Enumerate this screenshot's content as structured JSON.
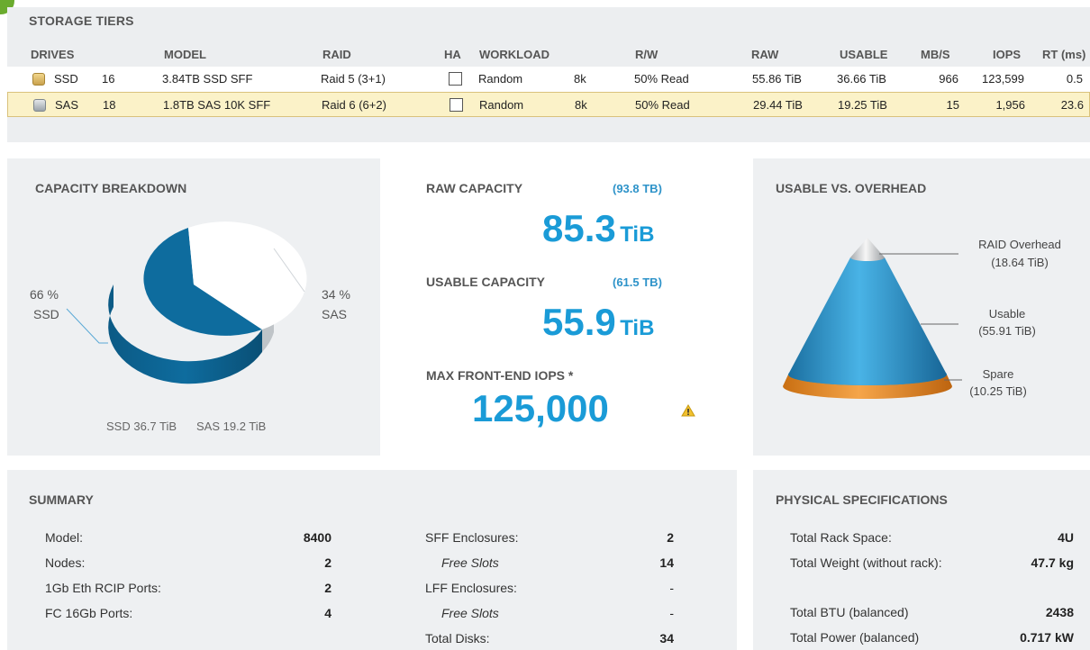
{
  "tiers": {
    "title": "STORAGE TIERS",
    "headers": [
      "DRIVES",
      "MODEL",
      "RAID",
      "HA",
      "WORKLOAD",
      "R/W",
      "RAW",
      "USABLE",
      "MB/S",
      "IOPS",
      "RT (ms)"
    ],
    "rows": [
      {
        "type": "SSD",
        "count": "16",
        "model": "3.84TB SSD SFF",
        "raid": "Raid 5 (3+1)",
        "ha": false,
        "workload": "Random",
        "block": "8k",
        "rw": "50% Read",
        "raw": "55.86 TiB",
        "usable": "36.66 TiB",
        "mbs": "966",
        "iops": "123,599",
        "rt": "0.5",
        "icon": "ssd-drive-icon"
      },
      {
        "type": "SAS",
        "count": "18",
        "model": "1.8TB SAS 10K SFF",
        "raid": "Raid 6 (6+2)",
        "ha": false,
        "workload": "Random",
        "block": "8k",
        "rw": "50% Read",
        "raw": "29.44 TiB",
        "usable": "19.25 TiB",
        "mbs": "15",
        "iops": "1,956",
        "rt": "23.6",
        "icon": "sas-drive-icon",
        "selected": true
      }
    ]
  },
  "capacity_breakdown": {
    "title": "CAPACITY BREAKDOWN",
    "ssd_pct": "66 %",
    "ssd_label": "SSD",
    "sas_pct": "34 %",
    "sas_label": "SAS",
    "ssd_fraction": 0.66,
    "legend_ssd": "SSD  36.7 TiB",
    "legend_sas": "SAS  19.2 TiB",
    "colors": {
      "ssd": "#0e6c9e",
      "sas": "#ffffff"
    }
  },
  "capacity": {
    "raw_label": "RAW CAPACITY",
    "raw_paren": "(93.8 TB)",
    "raw_value": "85.3",
    "raw_unit": "TiB",
    "usable_label": "USABLE CAPACITY",
    "usable_paren": "(61.5 TB)",
    "usable_value": "55.9",
    "usable_unit": "TiB",
    "iops_label": "MAX FRONT-END IOPS *",
    "iops_value": "125,000",
    "warning_icon": "warning-icon",
    "accent": "#1a9bd7"
  },
  "usable_overhead": {
    "title": "USABLE VS. OVERHEAD",
    "raid_label": "RAID Overhead",
    "raid_value": "(18.64 TiB)",
    "usable_label": "Usable",
    "usable_value": "(55.91 TiB)",
    "spare_label": "Spare",
    "spare_value": "(10.25 TiB)",
    "colors": {
      "raid": "#d9d9d9",
      "usable": "#2a91c6",
      "spare": "#e98b22"
    }
  },
  "summary": {
    "title": "SUMMARY",
    "left": [
      {
        "label": "Model:",
        "value": "8400"
      },
      {
        "label": "Nodes:",
        "value": "2"
      },
      {
        "label": "1Gb Eth RCIP Ports:",
        "value": "2"
      },
      {
        "label": "FC 16Gb Ports:",
        "value": "4"
      }
    ],
    "right": [
      {
        "label": "SFF Enclosures:",
        "value": "2"
      },
      {
        "label": "Free Slots",
        "value": "14"
      },
      {
        "label": "LFF Enclosures:",
        "value": "-"
      },
      {
        "label": "Free Slots",
        "value": "-"
      },
      {
        "label": "Total Disks:",
        "value": "34"
      }
    ]
  },
  "physical": {
    "title": "PHYSICAL SPECIFICATIONS",
    "items": [
      {
        "label": "Total Rack Space:",
        "value": "4U"
      },
      {
        "label": "Total Weight (without rack):",
        "value": "47.7 kg"
      },
      {
        "label": "Total BTU (balanced)",
        "value": "2438"
      },
      {
        "label": "Total Power (balanced)",
        "value": "0.717 kW"
      }
    ]
  }
}
